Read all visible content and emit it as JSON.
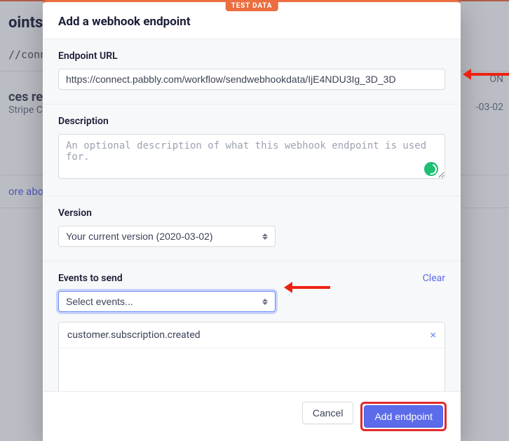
{
  "background": {
    "title_fragment": "oints",
    "url_fragment": "//connec",
    "heading_fragment": "ces rec",
    "sub_fragment": " Stripe CL",
    "link_fragment": "ore about",
    "right_mode": "ON",
    "right_date": "-03-02"
  },
  "modal": {
    "badge": "TEST DATA",
    "title": "Add a webhook endpoint",
    "endpoint": {
      "label": "Endpoint URL",
      "value": "https://connect.pabbly.com/workflow/sendwebhookdata/IjE4NDU3Ig_3D_3D"
    },
    "description": {
      "label": "Description",
      "placeholder": "An optional description of what this webhook endpoint is used for."
    },
    "version": {
      "label": "Version",
      "selected": "Your current version (2020-03-02)"
    },
    "events": {
      "label": "Events to send",
      "select_placeholder": "Select events...",
      "clear": "Clear",
      "items": [
        "customer.subscription.created"
      ]
    },
    "footer": {
      "cancel": "Cancel",
      "submit": "Add endpoint"
    }
  }
}
